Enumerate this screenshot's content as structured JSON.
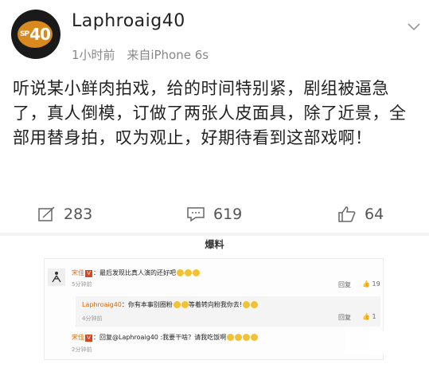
{
  "post": {
    "username": "Laphroaig40",
    "avatar_text": "40",
    "avatar_small": "SP",
    "time": "1小时前",
    "source": "来自iPhone 6s",
    "content": "听说某小鲜肉拍戏，给的时间特别紧，剧组被逼急了，真人倒模，订做了两张人皮面具，除了近景，全部用替身拍，叹为观止，好期待看到这部戏啊！",
    "icons": {
      "more": "chevron-down-icon"
    }
  },
  "actions": {
    "repost_count": "283",
    "comment_count": "619",
    "like_count": "64",
    "icons": [
      "repost-icon",
      "comment-icon",
      "like-icon"
    ]
  },
  "section_label": "爆料",
  "comments": [
    {
      "name": "宋佳",
      "text": "最后发现比真人演的还好吧",
      "time": "5分钟前",
      "reply_label": "回复",
      "like_count": "19"
    },
    {
      "name": "Laphroaig40",
      "text": "你有本事别圈粉",
      "text2": "等着转向粉我你去!",
      "time": "4分钟前",
      "reply_label": "回复",
      "like_count": "1"
    },
    {
      "name": "宋佳",
      "text": "回复@Laphroaig40 :我要干啥？请我吃饭啊",
      "time": "2分钟前"
    }
  ],
  "colors": {
    "accent": "#e06a00",
    "badge": "#e0431b",
    "text": "#222222",
    "muted": "#888888"
  }
}
